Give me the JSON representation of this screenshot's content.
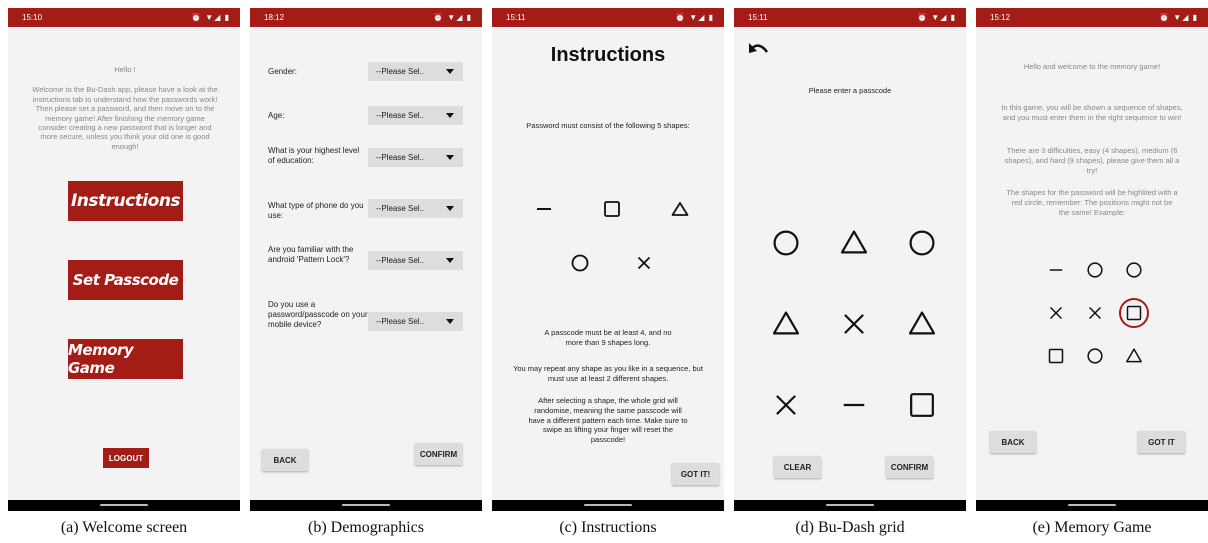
{
  "colors": {
    "status_bar": "#a31d16",
    "accent_red": "#a31d16",
    "screen_bg": "#f3f3f3",
    "button_gray": "#dddddd"
  },
  "panels": [
    {
      "time": "15:10",
      "caption": "(a) Welcome screen"
    },
    {
      "time": "18:12",
      "caption": "(b) Demographics"
    },
    {
      "time": "15:11",
      "caption": "(c) Instructions"
    },
    {
      "time": "15:11",
      "caption": "(d) Bu-Dash grid"
    },
    {
      "time": "15:12",
      "caption": "(e) Memory Game"
    }
  ],
  "status_icons": "⏰ ▼◢ ▮",
  "welcome": {
    "hello": "Hello !",
    "message": "Welcome to the Bu-Dash app, please have a look at the instructions tab to understand how the passwords work! Then please set a password, and then move on to the memory game! After finishing the memory game consider creating a new password that is longer and more secure, unless you think your old one is good enough!",
    "instructions_button": "Instructions",
    "set_passcode_button": "Set Passcode",
    "memory_game_button": "Memory Game",
    "logout_button": "LOGOUT"
  },
  "demographics": {
    "questions": [
      {
        "label": "Gender:",
        "value": "--Please Sel.."
      },
      {
        "label": "Age:",
        "value": "--Please Sel.."
      },
      {
        "label": "What is your highest level of education:",
        "value": "--Please Sel.."
      },
      {
        "label": "What type of phone do you use:",
        "value": "--Please Sel.."
      },
      {
        "label": "Are you familiar with the android 'Pattern Lock'?",
        "value": "--Please Sel.."
      },
      {
        "label": "Do you use a password/passcode on your mobile device?",
        "value": "--Please Sel.."
      }
    ],
    "back_button": "BACK",
    "confirm_button": "CONFIRM"
  },
  "instructions": {
    "title": "Instructions",
    "intro": "Password must consist of the following 5 shapes:",
    "shapes": [
      "dash",
      "square",
      "triangle",
      "circle",
      "cross"
    ],
    "rule_length": "A passcode must be at least 4, and no more than 9 shapes long.",
    "rule_repeat": "You may repeat any shape as you like in a sequence, but must use at least 2 different shapes.",
    "rule_randomise": "After selecting a shape, the whole grid will randomise, meaning the same passcode will have a different pattern each time. Make sure to swipe as lifting your finger will reset the passcode!",
    "got_it_button": "GOT IT!"
  },
  "grid": {
    "prompt": "Please enter a passcode",
    "cells": [
      "circle",
      "triangle",
      "circle",
      "triangle",
      "cross",
      "triangle",
      "cross",
      "dash",
      "square"
    ],
    "clear_button": "CLEAR",
    "confirm_button": "CONFIRM",
    "back_icon": "undo-arrow-icon"
  },
  "memory": {
    "hello": "Hello and welcome to the memory game!",
    "p1": "In this game, you will be shown a sequence of shapes, and you must enter them in the right sequence to win!",
    "p2": "There are 3 difficulties, easy (4 shapes), medium (6 shapes), and hard (9 shapes), please give them all a try!",
    "p3": "The shapes for the password will be highlited with a red circle, remember: The positions might not be the same! Example:",
    "cells": [
      "dash",
      "circle",
      "circle",
      "cross",
      "cross",
      "square",
      "square",
      "circle",
      "triangle"
    ],
    "highlighted_cell": 5,
    "back_button": "BACK",
    "got_it_button": "GOT IT"
  }
}
